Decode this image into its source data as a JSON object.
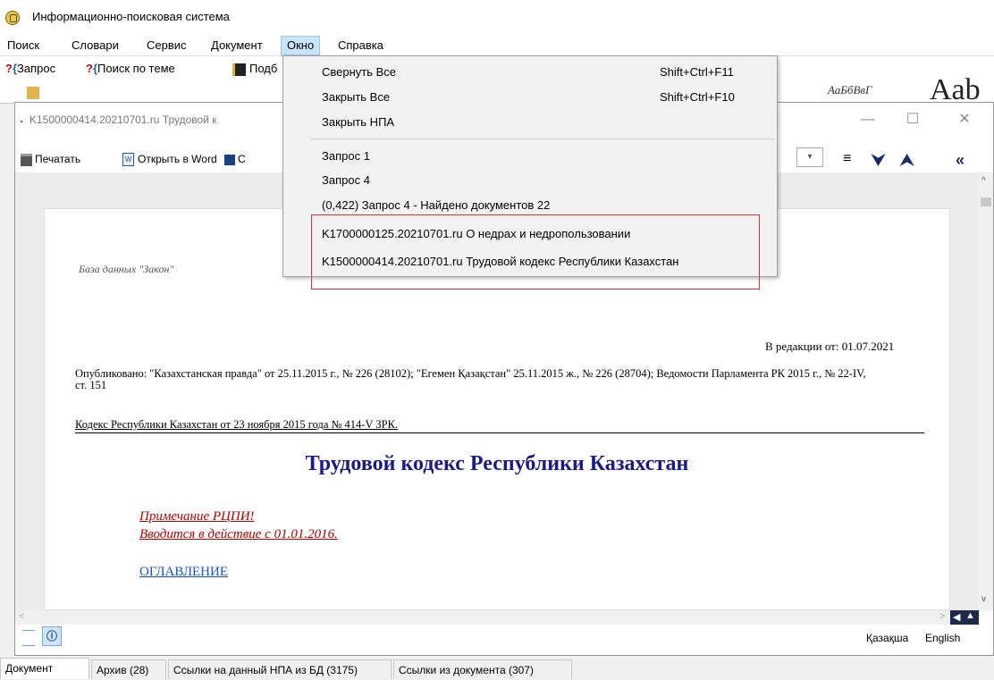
{
  "app": {
    "title": "Информационно-поисковая система"
  },
  "menubar": {
    "items": [
      "Поиск",
      "Словари",
      "Сервис",
      "Документ",
      "Окно",
      "Справка"
    ]
  },
  "main_toolbar": {
    "query": "Запрос",
    "topic_search": "Поиск по теме",
    "sel_partial": "Подб"
  },
  "background": {
    "font_sample": "АаБбВвГ",
    "font_big": "Aab"
  },
  "child_window": {
    "title": "K1500000414.20210701.ru  Трудовой к",
    "toolbar": {
      "print": "Печатать",
      "open_word": "Открыть в Word",
      "partial": "С"
    },
    "controls": {
      "minimize": "—",
      "maximize": "☐",
      "close": "✕"
    }
  },
  "document": {
    "db_label": "База данных \"Закон\"",
    "edition": "В редакции от: 01.07.2021",
    "published": "Опубликовано: \"Казахстанская правда\" от 25.11.2015 г., № 226 (28102); \"Егемен Қазақстан\" 25.11.2015 ж., № 226 (28704); Ведомости Парламента РК 2015 г., № 22-IV, ст. 151",
    "code_line": "Кодекс Республики Казахстан от 23 ноября 2015 года № 414-V ЗРК.",
    "heading": "Трудовой кодекс Республики Казахстан",
    "note_title": "Примечание РЦПИ!",
    "note_body": "Вводится в действие с 01.01.2016.",
    "toc_link": "ОГЛАВЛЕНИЕ"
  },
  "status": {
    "lang_kz": "Қазақша",
    "lang_en": "English"
  },
  "bottom_tabs": [
    "Документ",
    "Архив (28)",
    "Ссылки на данный НПА из БД (3175)",
    "Ссылки из документа (307)"
  ],
  "window_menu": {
    "collapse_all": "Свернуть Все",
    "collapse_all_sc": "Shift+Ctrl+F11",
    "close_all": "Закрыть Все",
    "close_all_sc": "Shift+Ctrl+F10",
    "close_npa": "Закрыть НПА",
    "query1": "Запрос 1",
    "query4": "Запрос 4",
    "query4_found": "(0,422) Запрос 4   -  Найдено документов   22",
    "doc1": "K1700000125.20210701.ru  О недрах и недропользовании",
    "doc2": "K1500000414.20210701.ru  Трудовой кодекс Республики Казахстан"
  },
  "colors": {
    "heading": "#1a1a8c",
    "note": "#b00000",
    "link": "#1a4fd0",
    "highlight_box": "#e03030"
  }
}
